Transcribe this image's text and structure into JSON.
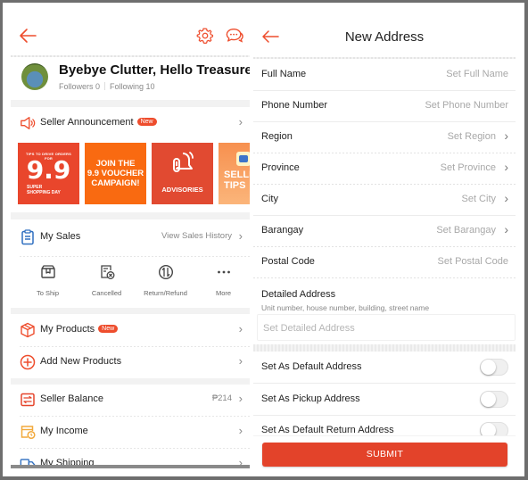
{
  "left": {
    "header": {
      "back_icon": "arrow-left-icon",
      "settings_icon": "gear-icon",
      "chat_icon": "chat-bubble-icon"
    },
    "profile": {
      "shop_name": "Byebye Clutter, Hello Treasure",
      "followers": "Followers 0",
      "following": "Following 10"
    },
    "announcement": {
      "label": "Seller Announcement",
      "badge": "New"
    },
    "banners": [
      {
        "kicker": "TIPS TO DRIVE ORDERS FOR",
        "headline": "9.9",
        "sub_line1": "SUPER",
        "sub_line2": "SHOPPING DAY"
      },
      {
        "line1": "JOIN THE",
        "line2": "9.9 VOUCHER",
        "line3": "CAMPAIGN!"
      },
      {
        "label": "ADVISORIES"
      },
      {
        "line1": "SELLER",
        "line2": "TIPS"
      }
    ],
    "my_sales": {
      "label": "My Sales",
      "link": "View Sales History",
      "actions": [
        {
          "label": "To Ship",
          "icon": "box-icon"
        },
        {
          "label": "Cancelled",
          "icon": "cancelled-order-icon"
        },
        {
          "label": "Return/Refund",
          "icon": "return-refund-icon"
        },
        {
          "label": "More",
          "icon": "more-dots-icon"
        }
      ]
    },
    "menu": [
      {
        "label": "My Products",
        "badge": "New",
        "icon": "product-box-icon"
      },
      {
        "label": "Add New Products",
        "icon": "plus-circle-icon"
      },
      {
        "label": "Seller Balance",
        "value": "₱214",
        "icon": "wallet-icon"
      },
      {
        "label": "My Income",
        "icon": "income-icon"
      },
      {
        "label": "My Shipping",
        "icon": "truck-icon"
      }
    ]
  },
  "right": {
    "title": "New Address",
    "fields": [
      {
        "label": "Full Name",
        "placeholder": "Set Full Name",
        "chevron": false
      },
      {
        "label": "Phone Number",
        "placeholder": "Set Phone Number",
        "chevron": false
      },
      {
        "label": "Region",
        "placeholder": "Set Region",
        "chevron": true
      },
      {
        "label": "Province",
        "placeholder": "Set Province",
        "chevron": true
      },
      {
        "label": "City",
        "placeholder": "Set City",
        "chevron": true
      },
      {
        "label": "Barangay",
        "placeholder": "Set Barangay",
        "chevron": true
      },
      {
        "label": "Postal Code",
        "placeholder": "Set Postal Code",
        "chevron": false
      }
    ],
    "detailed_address": {
      "label": "Detailed Address",
      "hint": "Unit number, house number, building, street name",
      "placeholder": "Set Detailed Address"
    },
    "toggles": [
      {
        "label": "Set As Default Address",
        "on": false
      },
      {
        "label": "Set As Pickup Address",
        "on": false
      },
      {
        "label": "Set As Default Return Address",
        "on": false
      }
    ],
    "submit_label": "SUBMIT"
  },
  "colors": {
    "accent": "#ee4d2d",
    "submit": "#e3432a",
    "placeholder": "#a8a8a8"
  }
}
